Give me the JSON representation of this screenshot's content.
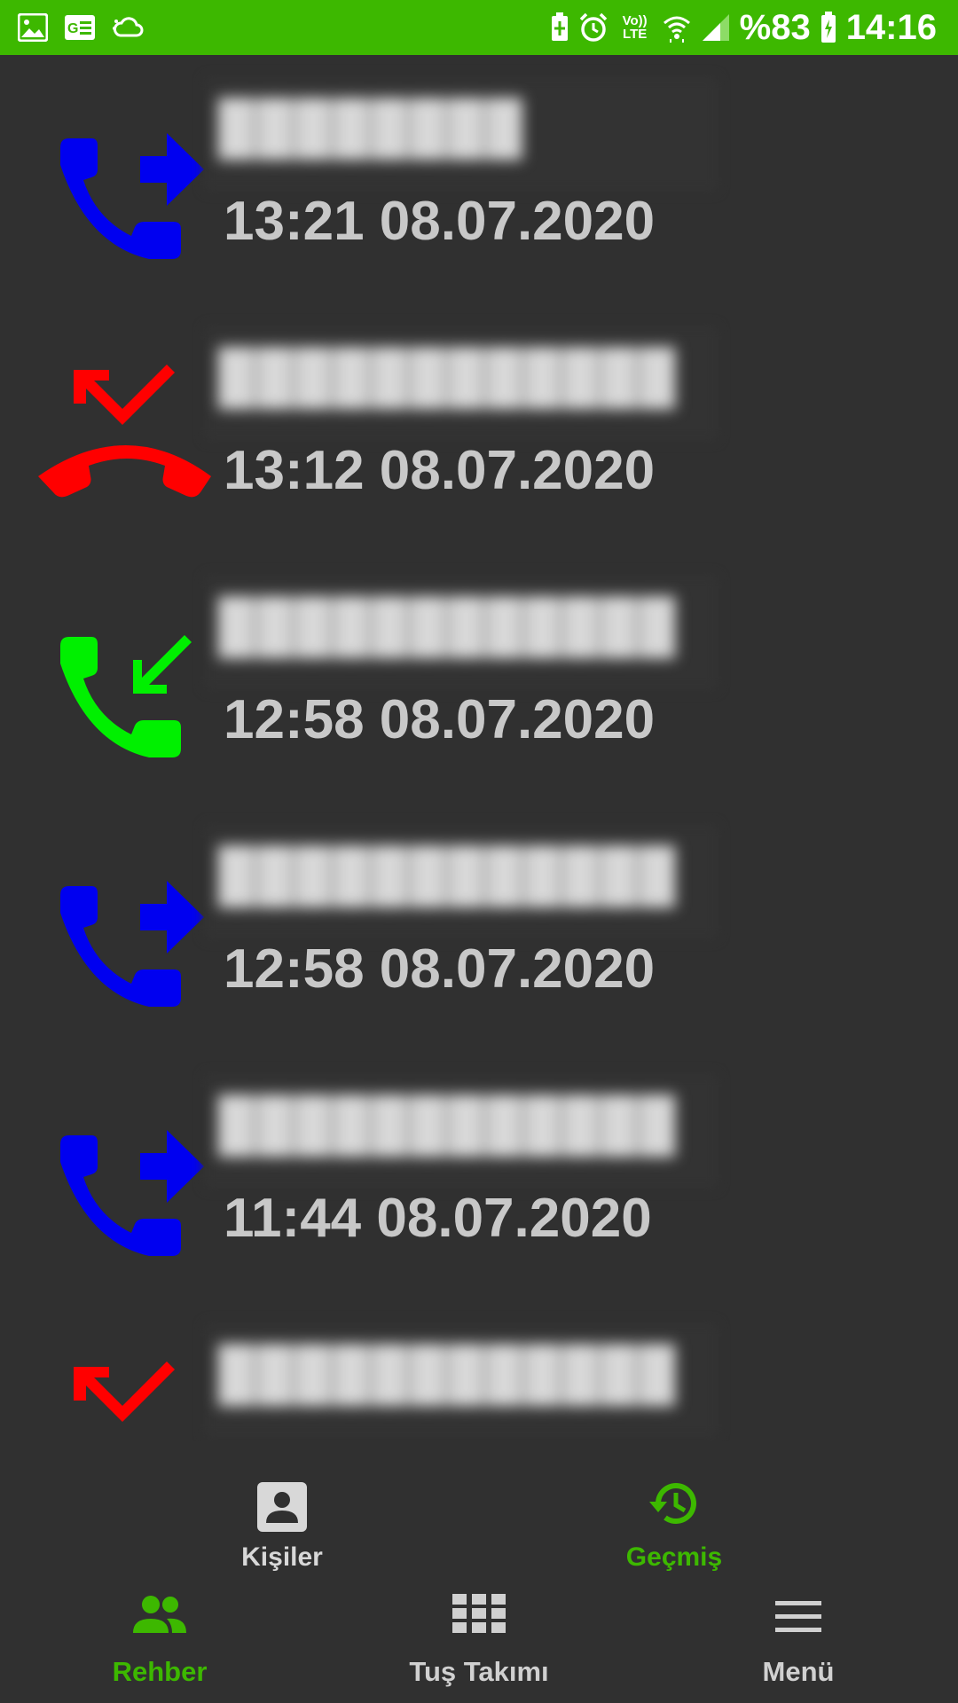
{
  "status_bar": {
    "battery_percent": "%83",
    "time": "14:16",
    "volte_top": "Vo))",
    "volte_bottom": "LTE",
    "icons": [
      "image-icon",
      "news-icon",
      "cloud-sync-icon",
      "battery-saver-icon",
      "alarm-icon",
      "volte-icon",
      "wifi-icon",
      "signal-icon",
      "battery-charging-icon"
    ],
    "background_color": "#3db800"
  },
  "calls": [
    {
      "type": "outgoing",
      "icon": "outgoing-call-icon",
      "number": "████████",
      "time": "13:21 08.07.2020",
      "color": "#0000f0"
    },
    {
      "type": "missed",
      "icon": "missed-call-icon",
      "number": "████████████",
      "time": "13:12 08.07.2020",
      "color": "#ff0000"
    },
    {
      "type": "incoming",
      "icon": "incoming-call-icon",
      "number": "████████████",
      "time": "12:58 08.07.2020",
      "color": "#00f000"
    },
    {
      "type": "outgoing",
      "icon": "outgoing-call-icon",
      "number": "████████████",
      "time": "12:58 08.07.2020",
      "color": "#0000f0"
    },
    {
      "type": "outgoing",
      "icon": "outgoing-call-icon",
      "number": "████████████",
      "time": "11:44 08.07.2020",
      "color": "#0000f0"
    },
    {
      "type": "missed",
      "icon": "missed-call-icon",
      "number": "████████████",
      "time": "",
      "color": "#ff0000"
    }
  ],
  "sub_tabs": [
    {
      "label": "Kişiler",
      "icon": "contact-card-icon",
      "active": false
    },
    {
      "label": "Geçmiş",
      "icon": "history-icon",
      "active": true
    }
  ],
  "bottom_nav": [
    {
      "label": "Rehber",
      "icon": "people-icon",
      "active": true
    },
    {
      "label": "Tuş Takımı",
      "icon": "dialpad-icon",
      "active": false
    },
    {
      "label": "Menü",
      "icon": "menu-icon",
      "active": false
    }
  ],
  "colors": {
    "accent": "#3db800",
    "background": "#303030",
    "text": "#c8c8c8",
    "inactive": "#d0d0d0"
  }
}
